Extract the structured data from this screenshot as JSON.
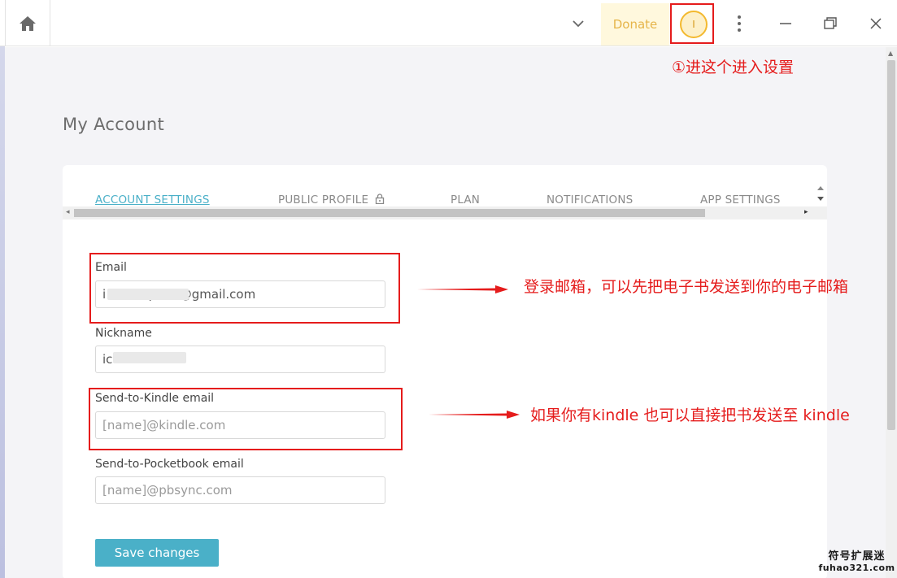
{
  "window": {
    "donate_label": "Donate",
    "avatar_initial": "I"
  },
  "page": {
    "title": "My Account"
  },
  "tabs": [
    {
      "label": "ACCOUNT SETTINGS",
      "active": true
    },
    {
      "label": "PUBLIC PROFILE",
      "locked": true
    },
    {
      "label": "PLAN"
    },
    {
      "label": "NOTIFICATIONS"
    },
    {
      "label": "APP SETTINGS"
    }
  ],
  "form": {
    "email": {
      "label": "Email",
      "value": "i           p      @gmail.com"
    },
    "nickname": {
      "label": "Nickname",
      "value": "ic"
    },
    "kindle": {
      "label": "Send-to-Kindle email",
      "placeholder": "[name]@kindle.com"
    },
    "pocketbook": {
      "label": "Send-to-Pocketbook email",
      "placeholder": "[name]@pbsync.com"
    },
    "save_label": "Save changes"
  },
  "annotations": {
    "settings_note": "①进这个进入设置",
    "email_note": "登录邮箱，可以先把电子书发送到你的电子邮箱",
    "kindle_note": "如果你有kindle 也可以直接把书发送至 kindle"
  },
  "watermark": {
    "line1": "符号扩展迷",
    "line2": "fuhao321.com"
  },
  "colors": {
    "accent": "#4ab0c8",
    "annotation_red": "#e51c1c",
    "donate_bg": "#fff8dd",
    "donate_text": "#e6b54a"
  }
}
